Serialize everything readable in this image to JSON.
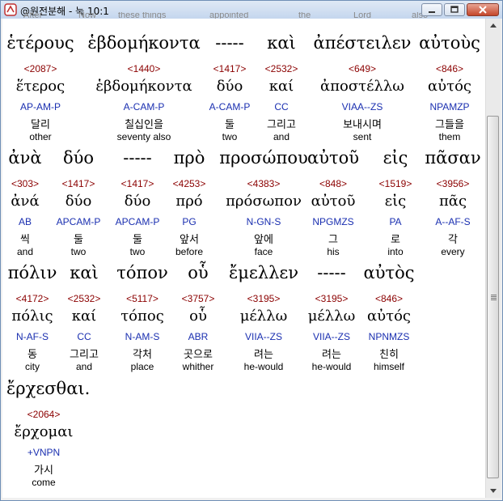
{
  "window": {
    "title": "@원전분해 - 눅 10:1",
    "behind_words": [
      "After",
      "Now",
      "these things",
      "appointed",
      "the",
      "Lord",
      "also"
    ]
  },
  "tokens": [
    {
      "greek": "ἑτέρους",
      "strong": "<2087>",
      "lemma": "ἕτερος",
      "morph": "AP-AM-P",
      "korean": "달리",
      "english": "other"
    },
    {
      "greek": "ἑβδομήκοντα",
      "strong": "<1440>",
      "lemma": "ἑβδομήκοντα",
      "morph": "A-CAM-P",
      "korean": "칠십인을",
      "english": "seventy also"
    },
    {
      "greek": "-----",
      "strong": "<1417>",
      "lemma": "δύο",
      "morph": "A-CAM-P",
      "korean": "둘",
      "english": "two"
    },
    {
      "greek": "καὶ",
      "strong": "<2532>",
      "lemma": "καί",
      "morph": "CC",
      "korean": "그리고",
      "english": "and"
    },
    {
      "greek": "ἀπέστειλεν",
      "strong": "<649>",
      "lemma": "ἀποστέλλω",
      "morph": "VIAA--ZS",
      "korean": "보내시며",
      "english": "sent"
    },
    {
      "greek": "αὐτοὺς",
      "strong": "<846>",
      "lemma": "αὐτός",
      "morph": "NPAMZP",
      "korean": "그들을",
      "english": "them"
    },
    {
      "greek": "ἀνὰ",
      "strong": "<303>",
      "lemma": "ἀνά",
      "morph": "AB",
      "korean": "씩",
      "english": "and"
    },
    {
      "greek": "δύο",
      "strong": "<1417>",
      "lemma": "δύο",
      "morph": "APCAM-P",
      "korean": "둘",
      "english": "two"
    },
    {
      "greek": "-----",
      "strong": "<1417>",
      "lemma": "δύο",
      "morph": "APCAM-P",
      "korean": "둘",
      "english": "two"
    },
    {
      "greek": "πρὸ",
      "strong": "<4253>",
      "lemma": "πρό",
      "morph": "PG",
      "korean": "앞서",
      "english": "before"
    },
    {
      "greek": "προσώπου",
      "strong": "<4383>",
      "lemma": "πρόσωπον",
      "morph": "N-GN-S",
      "korean": "앞에",
      "english": "face"
    },
    {
      "greek": "αὐτοῦ",
      "strong": "<848>",
      "lemma": "αὐτοῦ",
      "morph": "NPGMZS",
      "korean": "그",
      "english": "his"
    },
    {
      "greek": "εἰς",
      "strong": "<1519>",
      "lemma": "εἰς",
      "morph": "PA",
      "korean": "로",
      "english": "into"
    },
    {
      "greek": "πᾶσαν",
      "strong": "<3956>",
      "lemma": "πᾶς",
      "morph": "A--AF-S",
      "korean": "각",
      "english": "every"
    },
    {
      "greek": "πόλιν",
      "strong": "<4172>",
      "lemma": "πόλις",
      "morph": "N-AF-S",
      "korean": "동",
      "english": "city"
    },
    {
      "greek": "καὶ",
      "strong": "<2532>",
      "lemma": "καί",
      "morph": "CC",
      "korean": "그리고",
      "english": "and"
    },
    {
      "greek": "τόπον",
      "strong": "<5117>",
      "lemma": "τόπος",
      "morph": "N-AM-S",
      "korean": "각처",
      "english": "place"
    },
    {
      "greek": "οὗ",
      "strong": "<3757>",
      "lemma": "οὗ",
      "morph": "ABR",
      "korean": "곳으로",
      "english": "whither"
    },
    {
      "greek": "ἔμελλεν",
      "strong": "<3195>",
      "lemma": "μέλλω",
      "morph": "VIIA--ZS",
      "korean": "려는",
      "english": "he-would"
    },
    {
      "greek": "-----",
      "strong": "<3195>",
      "lemma": "μέλλω",
      "morph": "VIIA--ZS",
      "korean": "려는",
      "english": "he-would"
    },
    {
      "greek": "αὐτὸς",
      "strong": "<846>",
      "lemma": "αὐτός",
      "morph": "NPNMZS",
      "korean": "친히",
      "english": "himself"
    },
    {
      "greek": "ἔρχεσθαι.",
      "strong": "<2064>",
      "lemma": "ἔρχομαι",
      "morph": "+VNPN",
      "korean": "가시",
      "english": "come"
    }
  ]
}
